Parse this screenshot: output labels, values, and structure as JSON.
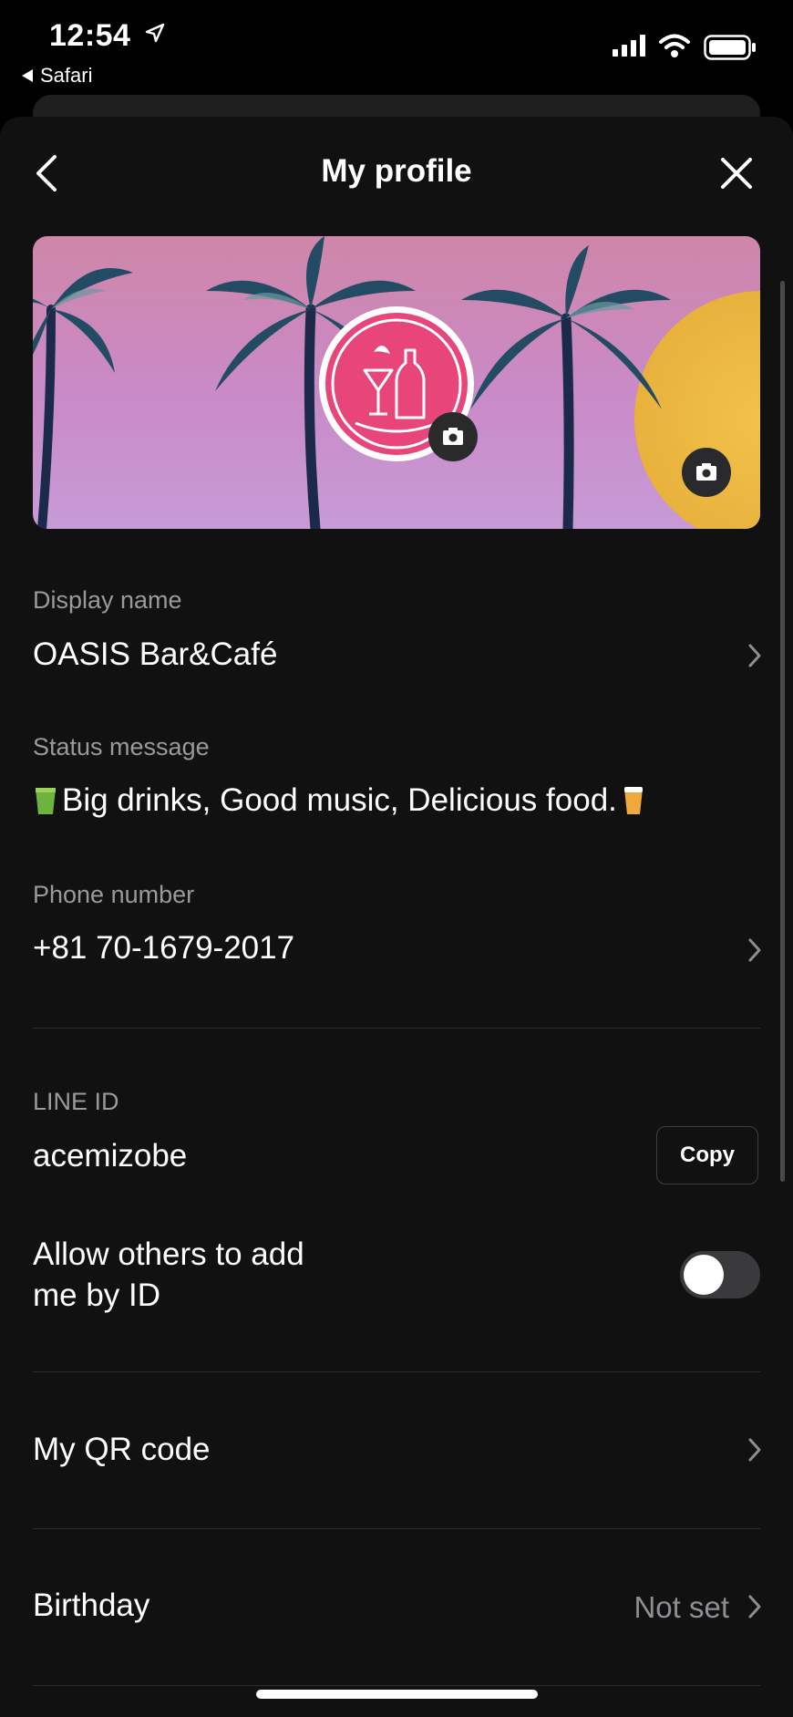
{
  "status_bar": {
    "time": "12:54",
    "back_app": "Safari",
    "icons": [
      "location-arrow-icon",
      "cellular-signal-icon",
      "wifi-icon",
      "battery-icon"
    ]
  },
  "header": {
    "title": "My profile",
    "back_icon": "chevron-left-icon",
    "close_icon": "close-icon"
  },
  "cover": {
    "camera_icon": "camera-icon"
  },
  "profile": {
    "display_name_label": "Display name",
    "display_name": "OASIS Bar&Café",
    "status_label": "Status message",
    "status_message": "Big drinks, Good music, Delicious food.",
    "phone_label": "Phone number",
    "phone": "+81 70-1679-2017"
  },
  "line_id": {
    "label": "LINE ID",
    "value": "acemizobe",
    "copy_label": "Copy",
    "allow_label_line1": "Allow others to add",
    "allow_label_line2": "me by ID",
    "allow_enabled": false
  },
  "menu": {
    "qr_label": "My QR code",
    "birthday_label": "Birthday",
    "birthday_value": "Not set"
  },
  "colors": {
    "background": "#111112",
    "secondary_text": "#9a9a9a",
    "cover_pink": "#cf86a8",
    "logo_pink": "#e8467a"
  }
}
